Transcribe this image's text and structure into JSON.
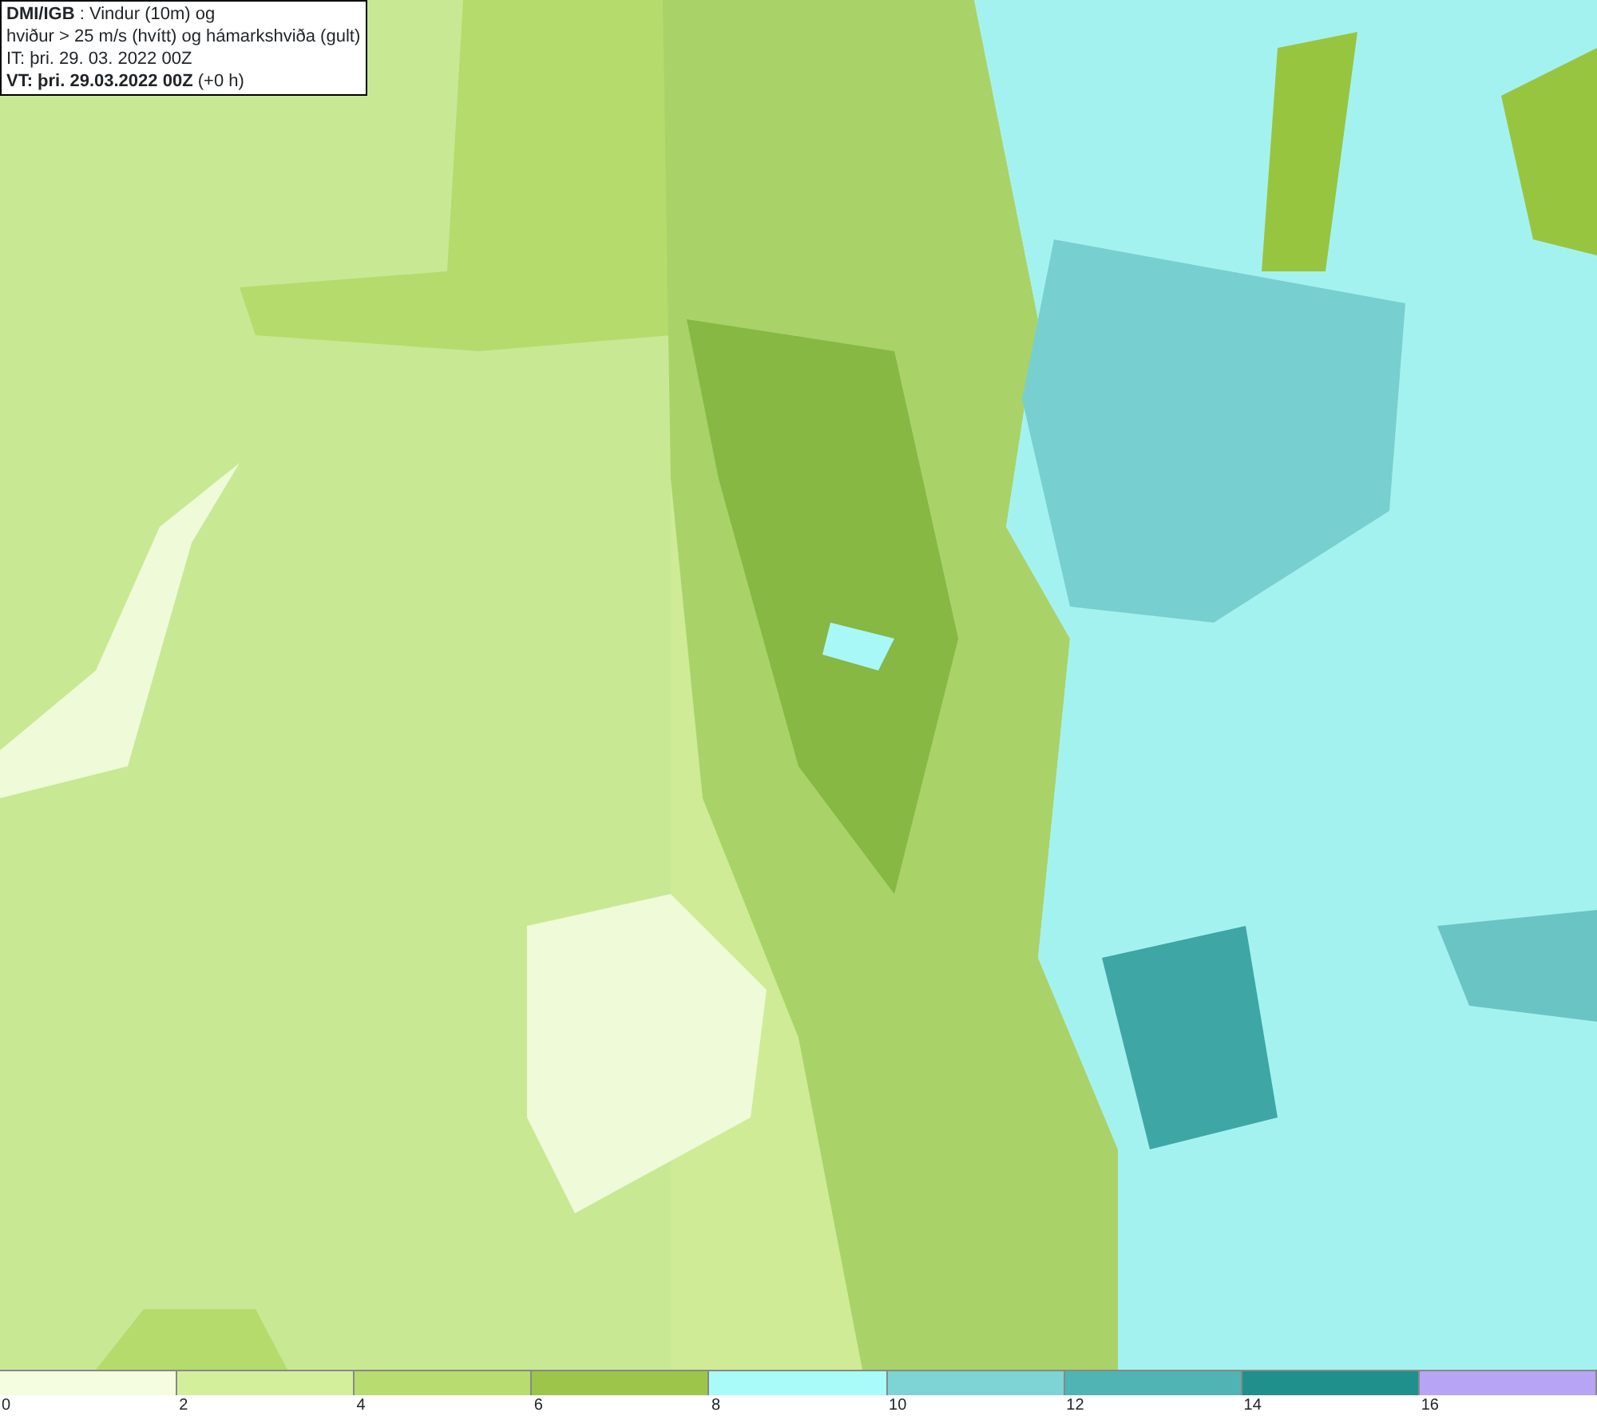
{
  "title_box": {
    "lines": [
      "**DMI/IGB** : Vindur (10m) og",
      "hviður > 25 m/s (hvítt) og hámarkshviða (gult)",
      "IT: þri. 29. 03. 2022 00Z",
      "**VT: þri. 29.03.2022 00Z** (+0 h)"
    ]
  },
  "legend": [
    {
      "label": "0",
      "color": "#f5fde0"
    },
    {
      "label": "2",
      "color": "#d4ef9c"
    },
    {
      "label": "4",
      "color": "#b8dc70"
    },
    {
      "label": "6",
      "color": "#9cc54a"
    },
    {
      "label": "8",
      "color": "#a8fbf8"
    },
    {
      "label": "10",
      "color": "#7ed4d4"
    },
    {
      "label": "12",
      "color": "#50b4b4"
    },
    {
      "label": "14",
      "color": "#20908c"
    },
    {
      "label": "16",
      "color": "#b7a4f4"
    }
  ]
}
